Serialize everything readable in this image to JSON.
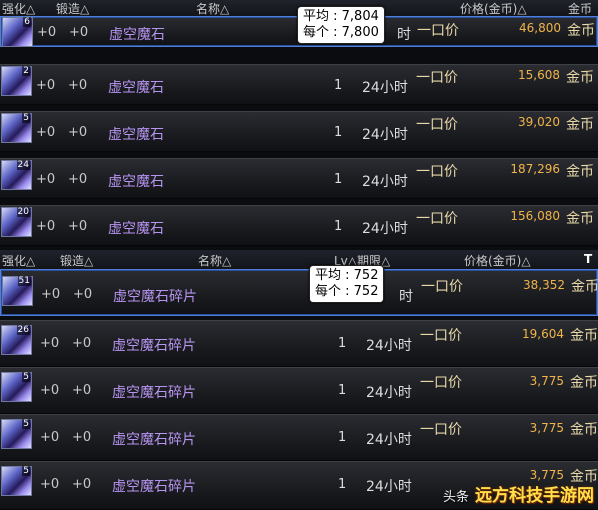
{
  "top_table": {
    "headers": {
      "enhance": "强化△",
      "forge": "锻造△",
      "name": "名称△",
      "price": "价格(金币)△",
      "currency": "金币"
    },
    "tooltip": {
      "avg_label": "平均 : ",
      "avg_value": "7,804",
      "each_label": "每个 : ",
      "each_value": "7,800"
    },
    "rows": [
      {
        "count": "6",
        "enh": "+0",
        "forge": "+0",
        "name": "虚空魔石",
        "level": "",
        "duration": "时",
        "price_type": "一口价",
        "price": "46,800",
        "currency": "金币"
      },
      {
        "count": "2",
        "enh": "+0",
        "forge": "+0",
        "name": "虚空魔石",
        "level": "1",
        "duration": "24小时",
        "price_type": "一口价",
        "price": "15,608",
        "currency": "金币"
      },
      {
        "count": "5",
        "enh": "+0",
        "forge": "+0",
        "name": "虚空魔石",
        "level": "1",
        "duration": "24小时",
        "price_type": "一口价",
        "price": "39,020",
        "currency": "金币"
      },
      {
        "count": "24",
        "enh": "+0",
        "forge": "+0",
        "name": "虚空魔石",
        "level": "1",
        "duration": "24小时",
        "price_type": "一口价",
        "price": "187,296",
        "currency": "金币"
      },
      {
        "count": "20",
        "enh": "+0",
        "forge": "+0",
        "name": "虚空魔石",
        "level": "1",
        "duration": "24小时",
        "price_type": "一口价",
        "price": "156,080",
        "currency": "金币"
      }
    ]
  },
  "bottom_table": {
    "headers": {
      "enhance": "强化△",
      "forge": "锻造△",
      "name": "名称△",
      "lvl_period": "Lv△期限△",
      "price": "价格(金币)△",
      "currency": "T"
    },
    "tooltip": {
      "avg_label": "平均 : ",
      "avg_value": "752",
      "each_label": "每个 : ",
      "each_value": "752"
    },
    "rows": [
      {
        "count": "51",
        "enh": "+0",
        "forge": "+0",
        "name": "虚空魔石碎片",
        "level": "",
        "duration": "时",
        "price_type": "一口价",
        "price": "38,352",
        "currency": "金币"
      },
      {
        "count": "26",
        "enh": "+0",
        "forge": "+0",
        "name": "虚空魔石碎片",
        "level": "1",
        "duration": "24小时",
        "price_type": "一口价",
        "price": "19,604",
        "currency": "金币"
      },
      {
        "count": "5",
        "enh": "+0",
        "forge": "+0",
        "name": "虚空魔石碎片",
        "level": "1",
        "duration": "24小时",
        "price_type": "一口价",
        "price": "3,775",
        "currency": "金币"
      },
      {
        "count": "5",
        "enh": "+0",
        "forge": "+0",
        "name": "虚空魔石碎片",
        "level": "1",
        "duration": "24小时",
        "price_type": "一口价",
        "price": "3,775",
        "currency": "金币"
      },
      {
        "count": "5",
        "enh": "+0",
        "forge": "+0",
        "name": "虚空魔石碎片",
        "level": "1",
        "duration": "24小时",
        "price_type": "",
        "price": "3,775",
        "currency": "金币"
      }
    ]
  },
  "watermark": {
    "prefix": "头条",
    "text": "远方科技手游网"
  }
}
